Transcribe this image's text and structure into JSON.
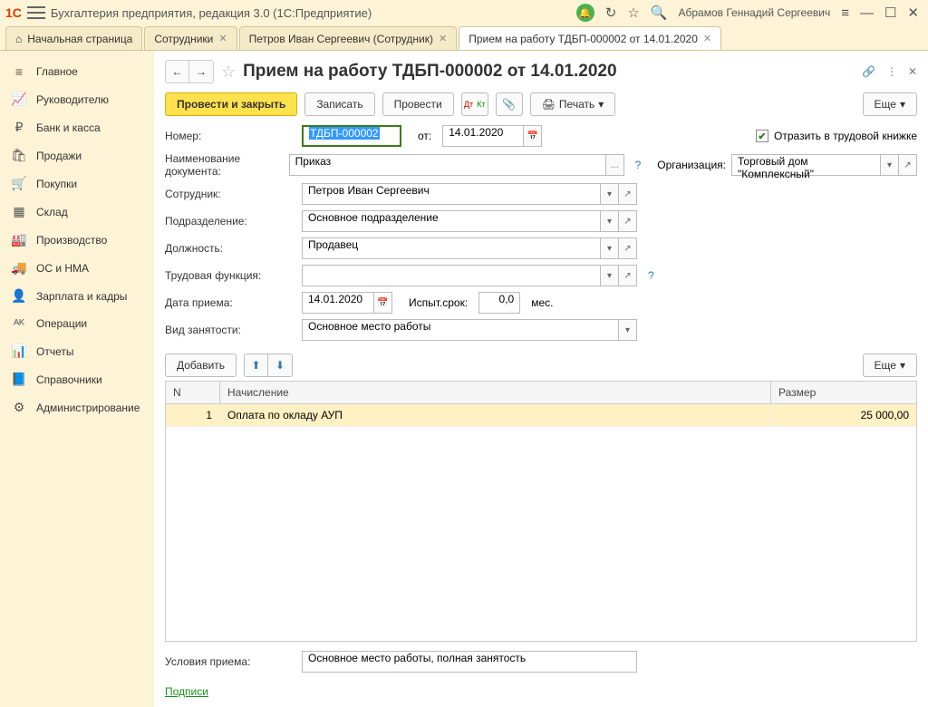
{
  "title": "Бухгалтерия предприятия, редакция 3.0  (1С:Предприятие)",
  "user": "Абрамов Геннадий Сергеевич",
  "tabs": [
    {
      "label": "Начальная страница",
      "closable": false,
      "home": true
    },
    {
      "label": "Сотрудники",
      "closable": true
    },
    {
      "label": "Петров Иван Сергеевич (Сотрудник)",
      "closable": true
    },
    {
      "label": "Прием на работу ТДБП-000002 от 14.01.2020",
      "closable": true,
      "active": true
    }
  ],
  "sidebar": [
    {
      "icon": "≡",
      "label": "Главное"
    },
    {
      "icon": "📈",
      "label": "Руководителю"
    },
    {
      "icon": "₽",
      "label": "Банк и касса"
    },
    {
      "icon": "🛍",
      "label": "Продажи"
    },
    {
      "icon": "🛒",
      "label": "Покупки"
    },
    {
      "icon": "▦",
      "label": "Склад"
    },
    {
      "icon": "🏭",
      "label": "Производство"
    },
    {
      "icon": "🚚",
      "label": "ОС и НМА"
    },
    {
      "icon": "👤",
      "label": "Зарплата и кадры"
    },
    {
      "icon": "ᴬᴷ",
      "label": "Операции"
    },
    {
      "icon": "📊",
      "label": "Отчеты"
    },
    {
      "icon": "📘",
      "label": "Справочники"
    },
    {
      "icon": "⚙",
      "label": "Администрирование"
    }
  ],
  "doc": {
    "title": "Прием на работу ТДБП-000002 от 14.01.2020",
    "buttons": {
      "post_close": "Провести и закрыть",
      "save": "Записать",
      "post": "Провести",
      "print": "Печать",
      "more": "Еще"
    },
    "fields": {
      "number_label": "Номер:",
      "number": "ТДБП-000002",
      "from_label": "от:",
      "date": "14.01.2020",
      "reflect_label": "Отразить в трудовой книжке",
      "docname_label": "Наименование документа:",
      "docname": "Приказ",
      "org_label": "Организация:",
      "org": "Торговый дом \"Комплексный\"",
      "employee_label": "Сотрудник:",
      "employee": "Петров Иван Сергеевич",
      "dept_label": "Подразделение:",
      "dept": "Основное подразделение",
      "position_label": "Должность:",
      "position": "Продавец",
      "func_label": "Трудовая функция:",
      "func": "",
      "hire_date_label": "Дата приема:",
      "hire_date": "14.01.2020",
      "probation_label": "Испыт.срок:",
      "probation": "0,0",
      "probation_unit": "мес.",
      "emp_type_label": "Вид занятости:",
      "emp_type": "Основное место работы",
      "add_btn": "Добавить",
      "cond_label": "Условия приема:",
      "cond": "Основное место работы, полная занятость",
      "sign_link": "Подписи"
    },
    "table": {
      "cols": {
        "n": "N",
        "accrual": "Начисление",
        "amount": "Размер"
      },
      "rows": [
        {
          "n": "1",
          "accrual": "Оплата по окладу АУП",
          "amount": "25 000,00"
        }
      ]
    }
  }
}
